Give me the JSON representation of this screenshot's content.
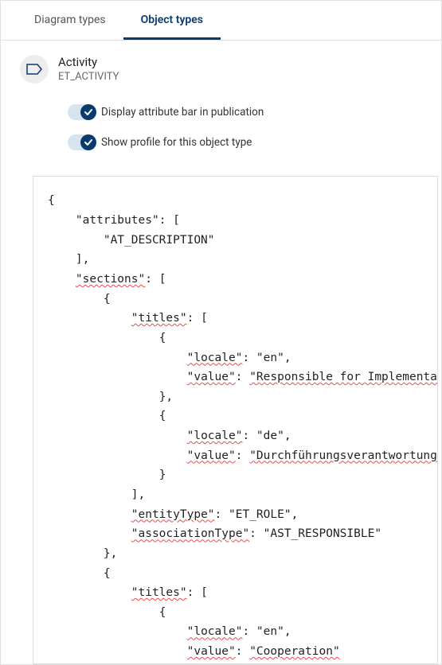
{
  "tabs": {
    "diagram": "Diagram types",
    "object": "Object types"
  },
  "header": {
    "title": "Activity",
    "subtitle": "ET_ACTIVITY"
  },
  "toggles": {
    "attr_bar": "Display attribute bar in publication",
    "profile": "Show profile for this object type"
  },
  "code": {
    "brace_open": "{",
    "brace_close": "}",
    "bracket_open": "[",
    "bracket_close": "]",
    "attributes_key": "\"attributes\"",
    "attributes_val": "\"AT_DESCRIPTION\"",
    "sections_key": "\"sections\"",
    "titles_key": "\"titles\"",
    "locale_key": "\"locale\"",
    "value_key": "\"value\"",
    "en": "\"en\"",
    "de": "\"de\"",
    "resp_impl": "\"Responsible for Implementation\"",
    "durch": "\"Durchführungsverantwortung\"",
    "entityType_key": "\"entityType\"",
    "entityType_val": "\"ET_ROLE\"",
    "associationType_key": "\"associationType\"",
    "associationType_val": "\"AST_RESPONSIBLE\"",
    "coop": "\"Cooperation\""
  }
}
